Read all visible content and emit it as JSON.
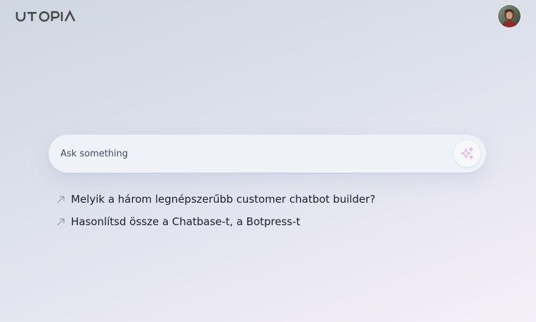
{
  "header": {
    "logo_text": "UTOPIA",
    "logo_color": "#4a4a4c",
    "avatar_icon": "user-avatar-photo"
  },
  "search": {
    "placeholder": "Ask something",
    "value": "",
    "button_icon": "sparkles-icon",
    "button_icon_color": "#e4b4ee"
  },
  "suggestions": {
    "arrow_icon": "arrow-up-right-icon",
    "items": [
      {
        "label": "Melyik a három legnépszerűbb customer chatbot builder?"
      },
      {
        "label": "Hasonlítsd össze a Chatbase-t, a Botpress-t"
      }
    ]
  }
}
